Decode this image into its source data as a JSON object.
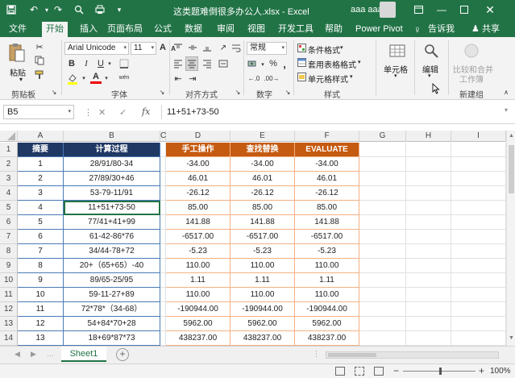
{
  "window": {
    "doc_title": "这类题难倒很多办公人.xlsx  -  Excel",
    "user_name": "aaa aaa",
    "share_label": "共享",
    "tell_me_label": "告诉我",
    "bulb_icon": "lightbulb-icon",
    "share_icon": "person-icon"
  },
  "tabs": [
    {
      "label": "文件"
    },
    {
      "label": "开始",
      "active": true
    },
    {
      "label": "插入"
    },
    {
      "label": "页面布局"
    },
    {
      "label": "公式"
    },
    {
      "label": "数据"
    },
    {
      "label": "审阅"
    },
    {
      "label": "视图"
    },
    {
      "label": "开发工具"
    },
    {
      "label": "帮助"
    },
    {
      "label": "Power Pivot"
    }
  ],
  "ribbon": {
    "clipboard": {
      "group_label": "剪贴板",
      "paste_label": "粘贴"
    },
    "font": {
      "group_label": "字体",
      "font_name": "Arial Unicode",
      "font_size": "11",
      "bold": "B",
      "italic": "I",
      "underline": "U",
      "grow": "A",
      "shrink": "A",
      "color_letter": "A",
      "phonetic": "wén"
    },
    "alignment": {
      "group_label": "对齐方式"
    },
    "number": {
      "group_label": "数字",
      "format": "常规",
      "percent": "%",
      "comma": ","
    },
    "styles": {
      "group_label": "样式",
      "conditional": "条件格式",
      "table": "套用表格格式",
      "cell_styles": "单元格样式"
    },
    "cells": {
      "label": "单元格"
    },
    "editing": {
      "label": "编辑"
    },
    "newgroup": {
      "group_label": "新建组",
      "merge_label_1": "比较和合并",
      "merge_label_2": "工作簿"
    }
  },
  "formula_bar": {
    "name_box": "B5",
    "cancel": "✕",
    "enter": "✓",
    "fx": "fx",
    "formula": "11+51+73-50"
  },
  "sheet": {
    "columns": [
      "A",
      "B",
      "C",
      "D",
      "E",
      "F",
      "G",
      "H",
      "I"
    ],
    "rows": [
      {
        "n": "1",
        "a": "摘要",
        "b": "计算过程",
        "d": "手工操作",
        "e": "查找替换",
        "f": "EVALUATE"
      },
      {
        "n": "2",
        "a": "1",
        "b": "28/91/80-34",
        "d": "-34.00",
        "e": "-34.00",
        "f": "-34.00"
      },
      {
        "n": "3",
        "a": "2",
        "b": "27/89/30+46",
        "d": "46.01",
        "e": "46.01",
        "f": "46.01"
      },
      {
        "n": "4",
        "a": "3",
        "b": "53-79-11/91",
        "d": "-26.12",
        "e": "-26.12",
        "f": "-26.12"
      },
      {
        "n": "5",
        "a": "4",
        "b": "11+51+73-50",
        "d": "85.00",
        "e": "85.00",
        "f": "85.00"
      },
      {
        "n": "6",
        "a": "5",
        "b": "77/41+41+99",
        "d": "141.88",
        "e": "141.88",
        "f": "141.88"
      },
      {
        "n": "7",
        "a": "6",
        "b": "61-42-86*76",
        "d": "-6517.00",
        "e": "-6517.00",
        "f": "-6517.00"
      },
      {
        "n": "8",
        "a": "7",
        "b": "34/44-78+72",
        "d": "-5.23",
        "e": "-5.23",
        "f": "-5.23"
      },
      {
        "n": "9",
        "a": "8",
        "b": "20+（65+65）-40",
        "d": "110.00",
        "e": "110.00",
        "f": "110.00"
      },
      {
        "n": "10",
        "a": "9",
        "b": "89/65-25/95",
        "d": "1.11",
        "e": "1.11",
        "f": "1.11"
      },
      {
        "n": "11",
        "a": "10",
        "b": "59-11-27+89",
        "d": "110.00",
        "e": "110.00",
        "f": "110.00"
      },
      {
        "n": "12",
        "a": "11",
        "b": "72*78*（34-68）",
        "d": "-190944.00",
        "e": "-190944.00",
        "f": "-190944.00"
      },
      {
        "n": "13",
        "a": "12",
        "b": "54+84*70+28",
        "d": "5962.00",
        "e": "5962.00",
        "f": "5962.00"
      },
      {
        "n": "14",
        "a": "13",
        "b": "18+69*87*73",
        "d": "438237.00",
        "e": "438237.00",
        "f": "438237.00"
      }
    ]
  },
  "sheet_tabs": {
    "name": "Sheet1",
    "add": "+"
  },
  "status": {
    "zoom": "100%",
    "zoom_minus": "−",
    "zoom_plus": "+"
  },
  "colors": {
    "accent": "#217346",
    "navy": "#1f3864",
    "orange": "#c55a11",
    "orange_border": "#f4b183"
  }
}
